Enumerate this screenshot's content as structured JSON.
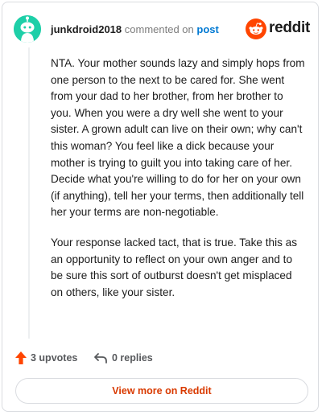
{
  "header": {
    "author": "junkdroid2018",
    "commented_on": "commented on",
    "post_link": "post",
    "brand": "reddit"
  },
  "comment": {
    "paragraphs": [
      "NTA. Your mother sounds lazy and simply hops from one person to the next to be cared for. She went from your dad to her brother, from her brother to you. When you were a dry well she went to your sister. A grown adult can live on their own; why can't this woman? You feel like a dick because your mother is trying to guilt you into taking care of her. Decide what you're willing to do for her on your own (if anything), tell her your terms, then additionally tell her your terms are non-negotiable.",
      "Your response lacked tact, that is true. Take this as an opportunity to reflect on your own anger and to be sure this sort of outburst doesn't get misplaced on others, like your sister."
    ]
  },
  "actions": {
    "upvotes": "3 upvotes",
    "replies": "0 replies"
  },
  "view_more": "View more on Reddit",
  "colors": {
    "avatar_bg": "#1ecfa8",
    "reddit_orange": "#ff4500",
    "link_blue": "#0079d3",
    "view_more_text": "#d93a00"
  },
  "icons": [
    "snoo-avatar-icon",
    "reddit-logo-icon",
    "upvote-arrow-icon",
    "reply-arrow-icon"
  ]
}
